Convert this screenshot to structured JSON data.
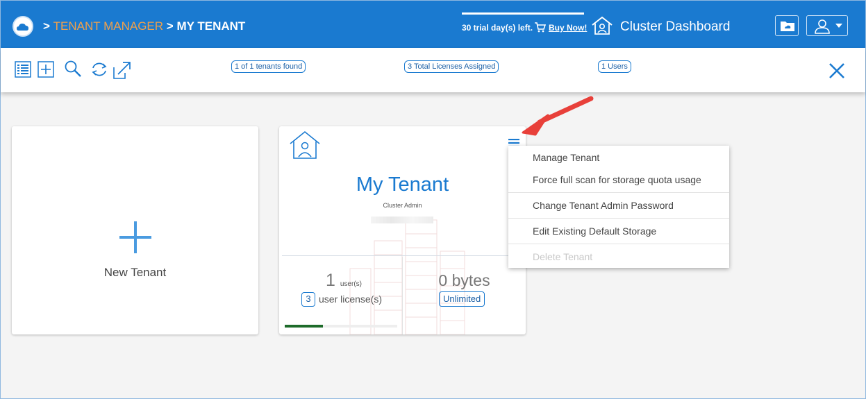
{
  "header": {
    "breadcrumb": {
      "sep1": ">",
      "parent": "TENANT MANAGER",
      "sep2": ">",
      "current": "MY TENANT"
    },
    "trial_text": "30 trial day(s) left.",
    "buy_now": "Buy Now!",
    "cluster_dashboard": "Cluster Dashboard",
    "icons": [
      "logo-icon",
      "cart-icon",
      "home-icon",
      "folder-icon",
      "user-icon",
      "chevron-down-icon"
    ]
  },
  "toolbar": {
    "icons": [
      "list-icon",
      "add-icon",
      "search-icon",
      "refresh-icon",
      "export-icon",
      "close-icon"
    ],
    "tenants_found": "1 of 1 tenants found",
    "licenses_assigned": "3 Total Licenses Assigned",
    "users_count": "1 Users"
  },
  "new_tenant": {
    "label": "New Tenant"
  },
  "tenant_card": {
    "name": "My Tenant",
    "role": "Cluster Admin",
    "users_value": "1",
    "users_unit": "user(s)",
    "licenses_value": "3",
    "licenses_unit": "user license(s)",
    "storage_value": "0 bytes",
    "storage_quota": "Unlimited",
    "usage_fraction": 0.34,
    "colors": {
      "accent": "#1a7ad0",
      "progress": "#1e6b2a"
    }
  },
  "menu": {
    "items": [
      {
        "label": "Manage Tenant",
        "enabled": true
      },
      {
        "label": "Force full scan for storage quota usage",
        "enabled": true
      },
      {
        "label": "Change Tenant Admin Password",
        "enabled": true
      },
      {
        "label": "Edit Existing Default Storage",
        "enabled": true
      },
      {
        "label": "Delete Tenant",
        "enabled": false
      }
    ]
  },
  "colors": {
    "header_bg": "#1a7ad0",
    "breadcrumb_link": "#f0a04b",
    "annotation_arrow": "#e8403a"
  }
}
